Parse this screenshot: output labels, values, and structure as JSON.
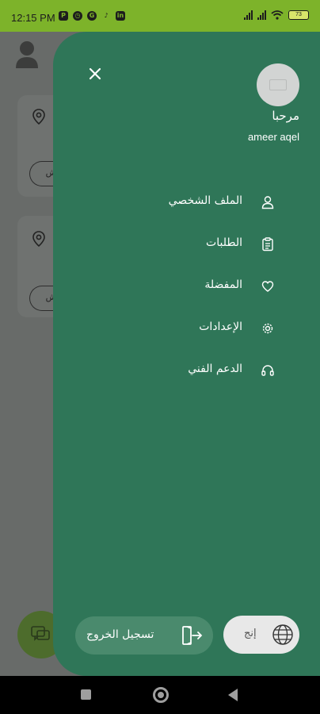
{
  "status_bar": {
    "time": "12:15 PM",
    "left_icons": [
      "P",
      "alarm",
      "G",
      "tiktok",
      "in"
    ],
    "battery": "73"
  },
  "drawer": {
    "greeting": "مرحبا",
    "username": "ameer aqel",
    "menu": [
      {
        "label": "الملف الشخصي",
        "icon": "person-icon"
      },
      {
        "label": "الطلبات",
        "icon": "clipboard-icon"
      },
      {
        "label": "المفضلة",
        "icon": "heart-icon"
      },
      {
        "label": "الإعدادات",
        "icon": "gear-icon"
      },
      {
        "label": "الدعم الفني",
        "icon": "headset-icon"
      }
    ],
    "logout_label": "تسجيل الخروج",
    "language_label": "إنج"
  },
  "background_page": {
    "pill_text_1": "ش",
    "pill_text_2": "ش"
  },
  "colors": {
    "status_bar": "#7db32a",
    "drawer": "#2f7658",
    "logout_button": "#4a8a6d",
    "language_button": "#e8e8e8"
  }
}
